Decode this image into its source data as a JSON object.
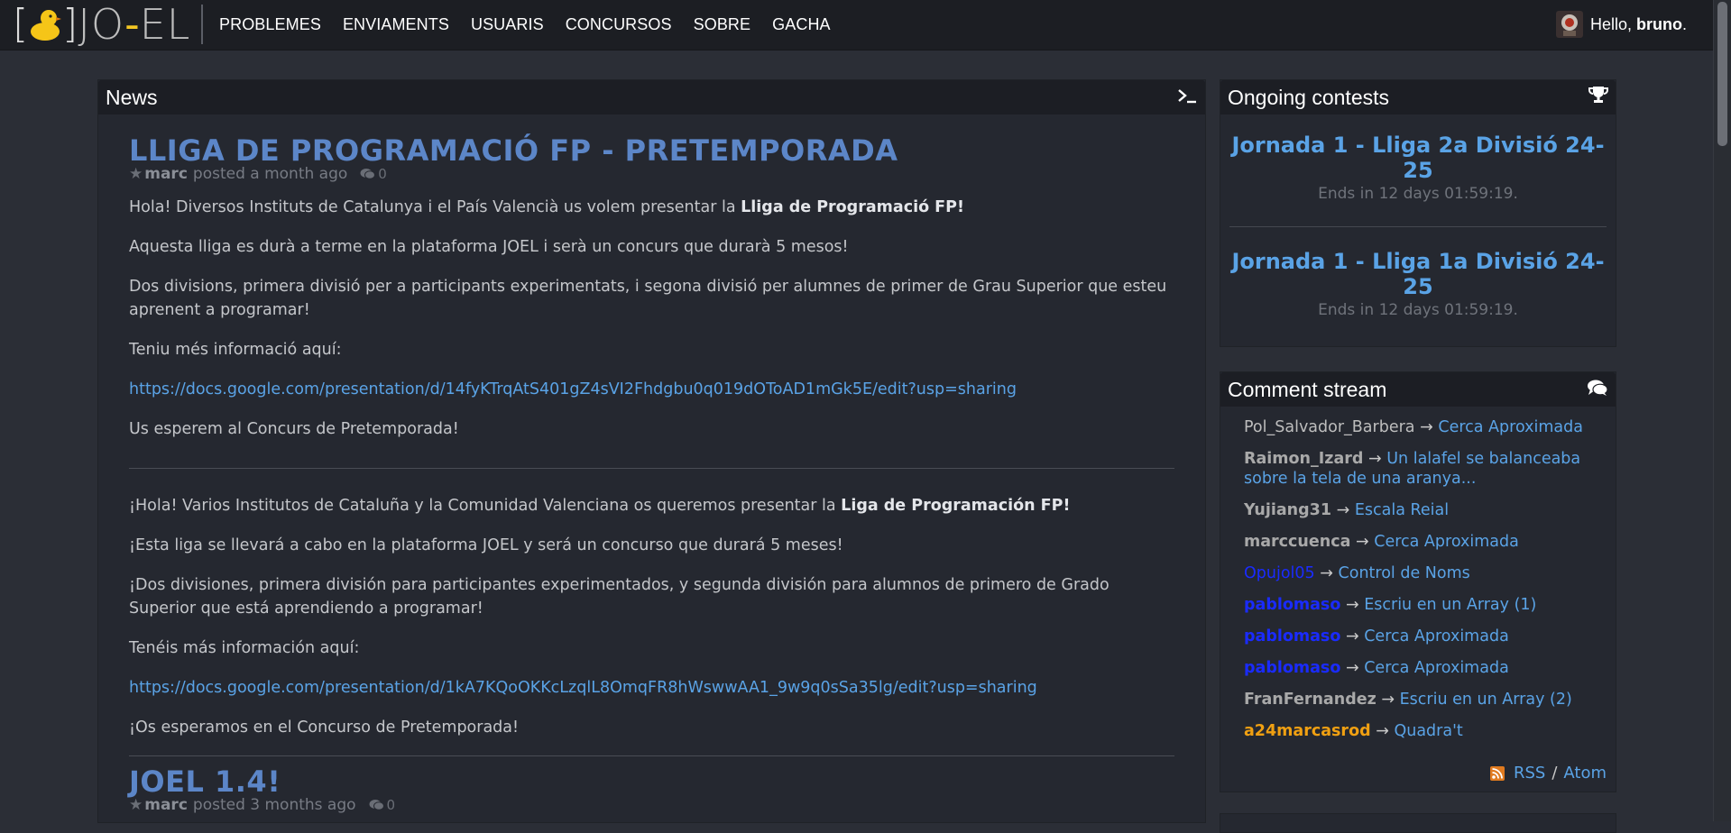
{
  "brand": {
    "left_bracket": "[",
    "right_bracket": "]",
    "text_a": "JO",
    "dash": "-",
    "text_b": "EL"
  },
  "nav": [
    "PROBLEMES",
    "ENVIAMENTS",
    "USUARIS",
    "CONCURSOS",
    "SOBRE",
    "GACHA"
  ],
  "user": {
    "greeting": "Hello,",
    "name": "bruno",
    "period": "."
  },
  "news": {
    "title": "News",
    "posts": [
      {
        "title": "LLIGA DE PROGRAMACIÓ FP - PRETEMPORADA",
        "author": "marc",
        "posted": "posted a month ago",
        "comments": "0",
        "p1_a": "Hola! Diversos Instituts de Catalunya i el País Valencià us volem presentar la ",
        "p1_b": "Lliga de Programació FP!",
        "p2": "Aquesta lliga es durà a terme en la plataforma JOEL i serà un concurs que durarà 5 mesos!",
        "p3": "Dos divisions, primera divisió per a participants experimentats, i segona divisió per alumnes de primer de Grau Superior que esteu aprenent a programar!",
        "p4": "Teniu més informació aquí:",
        "link1": "https://docs.google.com/presentation/d/14fyKTrqAtS401gZ4sVI2Fhdgbu0q019dOToAD1mGk5E/edit?usp=sharing",
        "p5": "Us esperem al Concurs de Pretemporada!",
        "es1_a": "¡Hola! Varios Institutos de Cataluña y la Comunidad Valenciana os queremos presentar la ",
        "es1_b": "Liga de Programación FP!",
        "es2": "¡Esta liga se llevará a cabo en la plataforma JOEL y será un concurso que durará 5 meses!",
        "es3": "¡Dos divisiones, primera división para participantes experimentados, y segunda división para alumnos de primero de Grado Superior que está aprendiendo a programar!",
        "es4": "Tenéis más información aquí:",
        "link2": "https://docs.google.com/presentation/d/1kA7KQoOKKcLzqlL8OmqFR8hWswwAA1_9w9q0sSa35lg/edit?usp=sharing",
        "es5": "¡Os esperamos en el Concurso de Pretemporada!"
      },
      {
        "title": "JOEL 1.4!",
        "author": "marc",
        "posted": "posted 3 months ago",
        "comments": "0"
      }
    ]
  },
  "contests": {
    "title": "Ongoing contests",
    "items": [
      {
        "title": "Jornada 1 - Lliga 2a Divisió 24-25",
        "ends": "Ends in 12 days 01:59:19."
      },
      {
        "title": "Jornada 1 - Lliga 1a Divisió 24-25",
        "ends": "Ends in 12 days 01:59:19."
      }
    ]
  },
  "comment_stream": {
    "title": "Comment stream",
    "items": [
      {
        "user": "Pol_Salvador_Barbera",
        "arrow": "→",
        "target": "Cerca Aproximada",
        "color": "#bdbdbd",
        "bold": false
      },
      {
        "user": "Raimon_Izard",
        "arrow": "→",
        "target": "Un lalafel se balanceaba sobre la tela de una aranya...",
        "color": "#a9a9a9",
        "bold": true
      },
      {
        "user": "Yujiang31",
        "arrow": "→",
        "target": "Escala Reial",
        "color": "#a9a9a9",
        "bold": true
      },
      {
        "user": "marccuenca",
        "arrow": "→",
        "target": "Cerca Aproximada",
        "color": "#a9a9a9",
        "bold": true
      },
      {
        "user": "Opujol05",
        "arrow": "→",
        "target": "Control de Noms",
        "color": "#1a2bff",
        "bold": false
      },
      {
        "user": "pablomaso",
        "arrow": "→",
        "target": "Escriu en un Array (1)",
        "color": "#1a2bff",
        "bold": true
      },
      {
        "user": "pablomaso",
        "arrow": "→",
        "target": "Cerca Aproximada",
        "color": "#1a2bff",
        "bold": true
      },
      {
        "user": "pablomaso",
        "arrow": "→",
        "target": "Cerca Aproximada",
        "color": "#1a2bff",
        "bold": true
      },
      {
        "user": "FranFernandez",
        "arrow": "→",
        "target": "Escriu en un Array (2)",
        "color": "#a9a9a9",
        "bold": true
      },
      {
        "user": "a24marcasrod",
        "arrow": "→",
        "target": "Quadra't",
        "color": "#f0a012",
        "bold": true
      }
    ],
    "rss": "RSS",
    "slash": "/",
    "atom": "Atom"
  },
  "icons": {
    "terminal": "terminal-icon",
    "trophy": "trophy-icon",
    "comments": "comments-icon",
    "rss": "rss-icon",
    "star": "star-icon",
    "comment": "comment-bubble-icon"
  }
}
